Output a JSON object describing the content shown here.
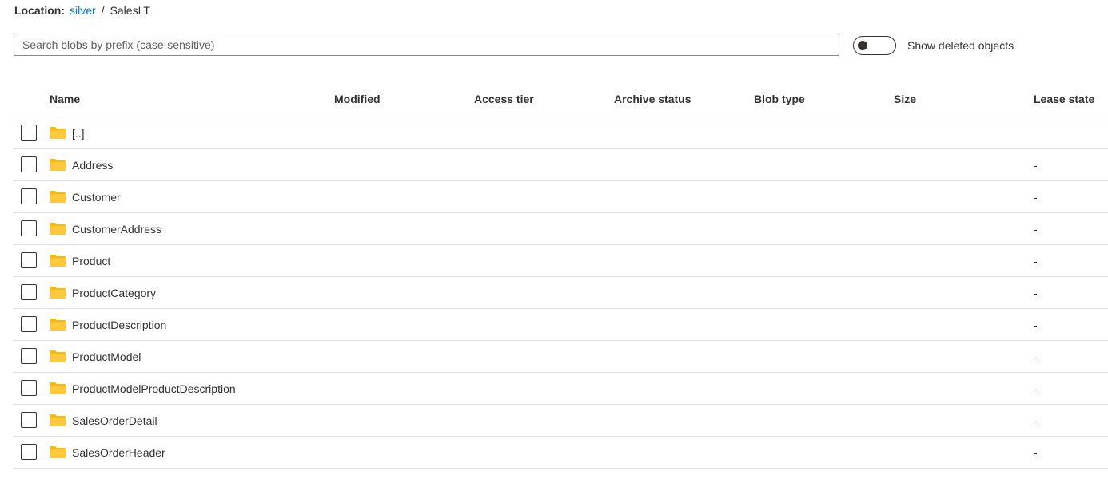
{
  "location": {
    "label": "Location:",
    "container": "silver",
    "separator": "/",
    "folder": "SalesLT"
  },
  "search": {
    "placeholder": "Search blobs by prefix (case-sensitive)",
    "value": ""
  },
  "toggle": {
    "label": "Show deleted objects",
    "on": false
  },
  "columns": {
    "name": "Name",
    "modified": "Modified",
    "access_tier": "Access tier",
    "archive_status": "Archive status",
    "blob_type": "Blob type",
    "size": "Size",
    "lease_state": "Lease state"
  },
  "rows": [
    {
      "name": "[..]",
      "lease": ""
    },
    {
      "name": "Address",
      "lease": "-"
    },
    {
      "name": "Customer",
      "lease": "-"
    },
    {
      "name": "CustomerAddress",
      "lease": "-"
    },
    {
      "name": "Product",
      "lease": "-"
    },
    {
      "name": "ProductCategory",
      "lease": "-"
    },
    {
      "name": "ProductDescription",
      "lease": "-"
    },
    {
      "name": "ProductModel",
      "lease": "-"
    },
    {
      "name": "ProductModelProductDescription",
      "lease": "-"
    },
    {
      "name": "SalesOrderDetail",
      "lease": "-"
    },
    {
      "name": "SalesOrderHeader",
      "lease": "-"
    }
  ],
  "icons": {
    "row_icon": "folder-icon",
    "folder_color": "#ffb900"
  }
}
